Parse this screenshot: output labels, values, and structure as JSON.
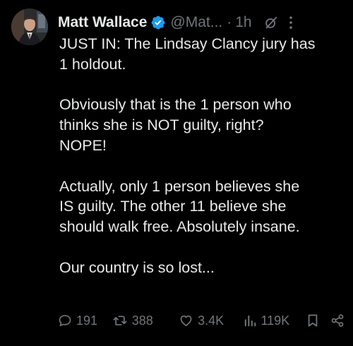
{
  "post": {
    "author": {
      "display_name": "Matt Wallace",
      "handle": "@Mat...",
      "verified": true,
      "avatar": "avatar-photo"
    },
    "separator": "·",
    "time": "1h",
    "icons": {
      "grok": "grok-icon",
      "more": "more-icon"
    },
    "paragraphs": [
      "JUST IN: The Lindsay Clancy jury has\n1 holdout.",
      "Obviously that is the 1 person who\nthinks she is NOT guilty, right?\nNOPE!",
      "Actually, only 1 person believes she\nIS guilty. The other 11 believe she\nshould walk free. Absolutely insane.",
      "Our country is so lost..."
    ],
    "actions": {
      "replies": "191",
      "reposts": "388",
      "likes": "3.4K",
      "views": "119K"
    }
  },
  "colors": {
    "background": "#000000",
    "text": "#e7e9ea",
    "secondary": "#71767b",
    "verified": "#1d9bf0"
  }
}
